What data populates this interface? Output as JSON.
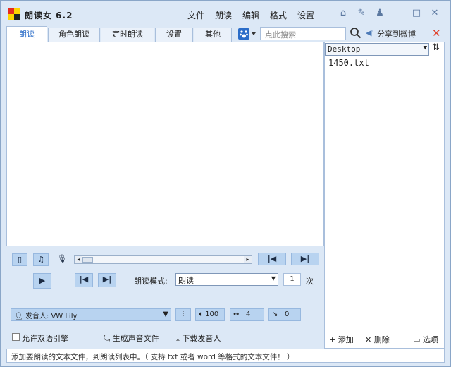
{
  "app": {
    "title": "朗读女 6.2"
  },
  "menu": [
    "文件",
    "朗读",
    "编辑",
    "格式",
    "设置"
  ],
  "titlebar_icons": [
    "home-icon",
    "pin-icon",
    "shirt-icon",
    "minimize-icon",
    "maximize-icon",
    "close-icon"
  ],
  "tabs": [
    {
      "label": "朗读",
      "active": true
    },
    {
      "label": "角色朗读",
      "active": false
    },
    {
      "label": "定时朗读",
      "active": false
    },
    {
      "label": "设置",
      "active": false
    },
    {
      "label": "其他",
      "active": false
    }
  ],
  "search": {
    "placeholder": "点此搜索"
  },
  "share": {
    "label": "分享到微博"
  },
  "file_browser": {
    "directory": "Desktop",
    "files": [
      "1450.txt"
    ]
  },
  "player": {
    "mode_label": "朗读模式:",
    "mode_value": "朗读",
    "times_value": "1",
    "times_unit": "次",
    "voice_label": "发音人: VW Lily",
    "volume": "100",
    "speed": "4",
    "pitch": "0"
  },
  "options": {
    "dual_engine_label": "允许双语引擎",
    "dual_engine_checked": false,
    "generate_audio_label": "生成声音文件",
    "download_voice_label": "下载发音人"
  },
  "list_actions": {
    "add_label": "添加",
    "delete_label": "删除",
    "options_label": "选项"
  },
  "status": {
    "text": "添加要朗读的文本文件，到朗读列表中。（ 支持 txt 或者 word 等格式的文本文件！ ）"
  },
  "colors": {
    "accent": "#2a6cc8",
    "panel": "#dce8f6",
    "button": "#b8d3f0",
    "close": "#e0402a"
  }
}
